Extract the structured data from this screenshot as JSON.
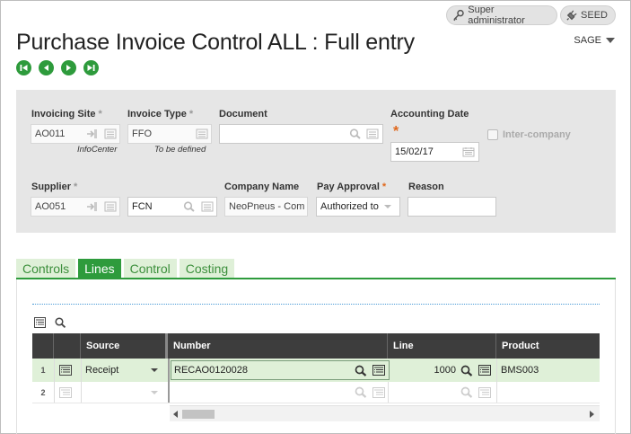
{
  "header": {
    "user_label": "Super administrator",
    "folder_label": "SEED",
    "title": "Purchase Invoice Control ALL : Full entry",
    "menu_label": "SAGE"
  },
  "form": {
    "invoicing_site": {
      "label": "Invoicing Site",
      "value": "AO011",
      "sub": "InfoCenter"
    },
    "invoice_type": {
      "label": "Invoice Type",
      "value": "FFO",
      "sub": "To be defined"
    },
    "document": {
      "label": "Document",
      "value": ""
    },
    "accounting_date": {
      "label": "Accounting Date",
      "value": "15/02/17"
    },
    "inter_company": {
      "label": "Inter-company"
    },
    "supplier": {
      "label": "Supplier",
      "value": "AO051"
    },
    "supplier_type": {
      "value": "FCN"
    },
    "company_name": {
      "label": "Company Name",
      "value": "NeoPneus - Com"
    },
    "pay_approval": {
      "label": "Pay Approval",
      "value": "Authorized to"
    },
    "reason": {
      "label": "Reason",
      "value": ""
    }
  },
  "tabs": [
    {
      "label": "Controls"
    },
    {
      "label": "Lines"
    },
    {
      "label": "Control"
    },
    {
      "label": "Costing"
    }
  ],
  "grid": {
    "columns": [
      "Source",
      "Number",
      "Line",
      "Product"
    ],
    "rows": [
      {
        "num": "1",
        "source": "Receipt",
        "number": "RECAO0120028",
        "line": "1000",
        "product": "BMS003"
      },
      {
        "num": "2",
        "source": "",
        "number": "",
        "line": "",
        "product": ""
      }
    ]
  },
  "colors": {
    "accent": "#2e9b3c",
    "row_selected": "#dff0d8",
    "required": "#e0681d"
  }
}
